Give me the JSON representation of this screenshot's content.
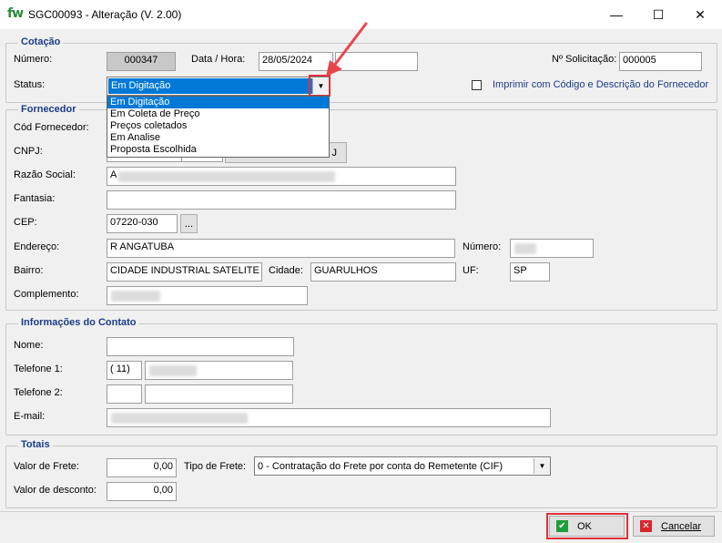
{
  "window": {
    "logo": "fw",
    "title": "SGC00093 - Alteração  (V. 2.00)",
    "minimize": "—",
    "maximize": "☐",
    "close": "✕"
  },
  "cotacao": {
    "group_title": "Cotação",
    "numero_label": "Número:",
    "numero_value": "000347",
    "data_hora_label": "Data / Hora:",
    "data_value": "28/05/2024",
    "hora_value": "",
    "solicitacao_label": "Nº Solicitação:",
    "solicitacao_value": "000005",
    "status_label": "Status:",
    "status_value": "Em Digitação",
    "status_options": [
      "Em Digitação",
      "Em Coleta de Preço",
      "Preços coletados",
      "Em Analise",
      "Proposta Escolhida"
    ],
    "imprimir_label": "Imprimir com Código e Descrição do Fornecedor",
    "imprimir_checked": false
  },
  "fornecedor": {
    "group_title": "Fornecedor",
    "cod_label": "Cód Fornecedor:",
    "cnpj_label": "CNPJ:",
    "cnpj_button_tail": "J",
    "razao_label": "Razão Social:",
    "razao_prefix": "A",
    "fantasia_label": "Fantasia:",
    "cep_label": "CEP:",
    "cep_value": "07220-030",
    "cep_button": "...",
    "endereco_label": "Endereço:",
    "endereco_value": "R ANGATUBA",
    "numero_label": "Número:",
    "bairro_label": "Bairro:",
    "bairro_value": "CIDADE INDUSTRIAL SATELITE",
    "cidade_label": "Cidade:",
    "cidade_value": "GUARULHOS",
    "uf_label": "UF:",
    "uf_value": "SP",
    "complemento_label": "Complemento:"
  },
  "contato": {
    "group_title": "Informações do Contato",
    "nome_label": "Nome:",
    "telefone1_label": "Telefone 1:",
    "telefone1_ddd": "( 11)",
    "telefone2_label": "Telefone 2:",
    "email_label": "E-mail:"
  },
  "totais": {
    "group_title": "Totais",
    "frete_label": "Valor de Frete:",
    "frete_value": "0,00",
    "tipo_frete_label": "Tipo de Frete:",
    "tipo_frete_value": "0 - Contratação do Frete por conta do Remetente (CIF)",
    "desconto_label": "Valor de desconto:",
    "desconto_value": "0,00"
  },
  "buttons": {
    "ok_label": "OK",
    "cancelar_label": "Cancelar"
  },
  "colors": {
    "accent": "#0078d7",
    "group_title": "#1c3b8a",
    "highlight": "#e0303a",
    "ok_icon": "#1e9e3a",
    "cancel_icon": "#d9262c"
  }
}
